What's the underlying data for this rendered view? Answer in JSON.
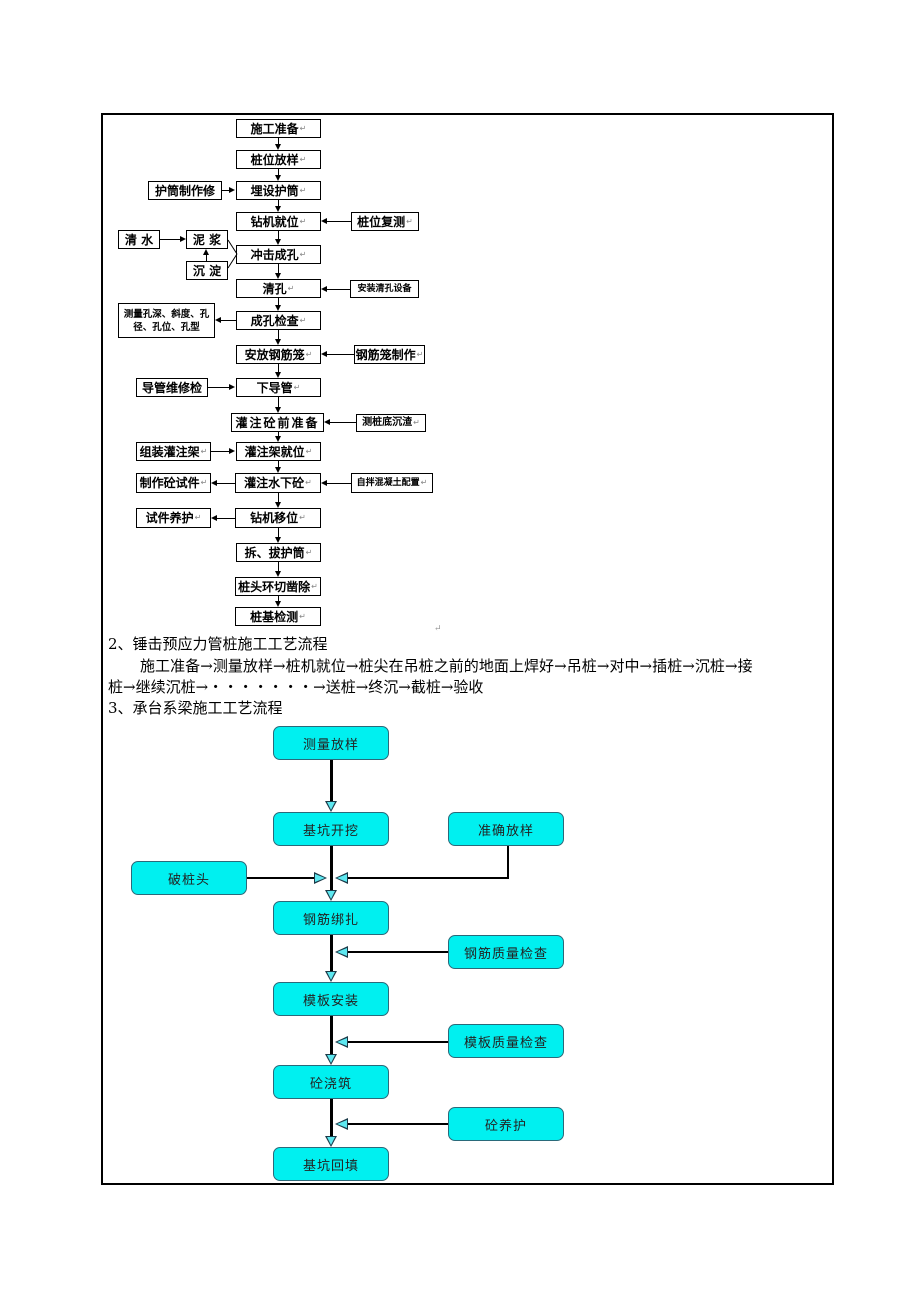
{
  "flow1": {
    "main": [
      "施工准备",
      "桩位放样",
      "埋设护筒",
      "钻机就位",
      "冲击成孔",
      "清孔",
      "成孔检查",
      "安放钢筋笼",
      "下导管",
      "灌注砼前准备",
      "灌注架就位",
      "灌注水下砼",
      "钻机移位",
      "拆、拔护筒",
      "桩头环切凿除",
      "桩基检测"
    ],
    "side": {
      "casing_make": "护筒制作修",
      "pile_recheck": "桩位复测",
      "clear_water": "清 水",
      "mud": "泥 浆",
      "settle": "沉 淀",
      "install_clean": "安装清孔设备",
      "measure_hole": "测量孔深、斜度、孔径、孔位、孔型",
      "cage_make": "钢筋笼制作",
      "pipe_repair": "导管维修检",
      "measure_sediment": "测桩底沉渣",
      "assemble_rack": "组装灌注架",
      "make_sample": "制作砼试件",
      "mix_concrete": "自拌混凝土配置",
      "sample_cure": "试件养护"
    },
    "para_mark": "↵"
  },
  "section2": {
    "heading": "2、锤击预应力管桩施工工艺流程",
    "line1": "施工准备→测量放样→桩机就位→桩尖在吊桩之前的地面上焊好→吊桩→对中→插桩→沉桩→接",
    "line2": "桩→继续沉桩→・・・・・・・→送桩→终沉→截桩→验收"
  },
  "section3": {
    "heading": "3、承台系梁施工工艺流程",
    "main": [
      "测量放样",
      "基坑开挖",
      "钢筋绑扎",
      "模板安装",
      "砼浇筑",
      "基坑回填"
    ],
    "side": {
      "accurate_layout": "准确放样",
      "break_pile_head": "破桩头",
      "rebar_check": "钢筋质量检查",
      "formwork_check": "模板质量检查",
      "concrete_cure": "砼养护"
    }
  }
}
